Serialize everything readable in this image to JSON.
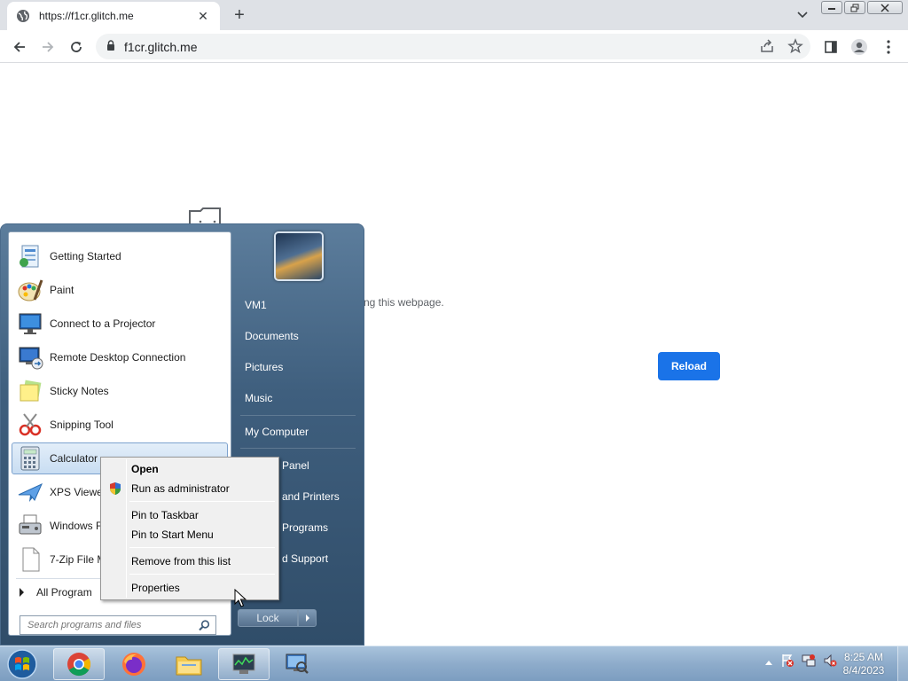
{
  "browser": {
    "tab_title": "https://f1cr.glitch.me",
    "url": "f1cr.glitch.me"
  },
  "page": {
    "error_message_visible": "ng this webpage.",
    "reload_label": "Reload"
  },
  "start_menu": {
    "programs": [
      {
        "label": "Getting Started",
        "icon": "getting-started-icon"
      },
      {
        "label": "Paint",
        "icon": "paint-icon"
      },
      {
        "label": "Connect to a Projector",
        "icon": "projector-icon"
      },
      {
        "label": "Remote Desktop Connection",
        "icon": "remote-desktop-icon"
      },
      {
        "label": "Sticky Notes",
        "icon": "sticky-notes-icon"
      },
      {
        "label": "Snipping Tool",
        "icon": "snipping-tool-icon"
      },
      {
        "label": "Calculator",
        "icon": "calculator-icon"
      },
      {
        "label": "XPS Viewer",
        "icon": "xps-viewer-icon"
      },
      {
        "label": "Windows Fa",
        "icon": "fax-icon"
      },
      {
        "label": "7-Zip File M",
        "icon": "file-icon"
      }
    ],
    "all_programs": "All Program",
    "search_placeholder": "Search programs and files",
    "right_items": [
      "VM1",
      "Documents",
      "Pictures",
      "Music",
      "My Computer",
      "Panel",
      "and Printers",
      "Programs",
      "d Support"
    ],
    "lock_label": "Lock"
  },
  "context_menu": {
    "items": [
      "Open",
      "Run as administrator",
      "Pin to Taskbar",
      "Pin to Start Menu",
      "Remove from this list",
      "Properties"
    ]
  },
  "taskbar": {
    "time": "8:25 AM",
    "date": "8/4/2023"
  }
}
